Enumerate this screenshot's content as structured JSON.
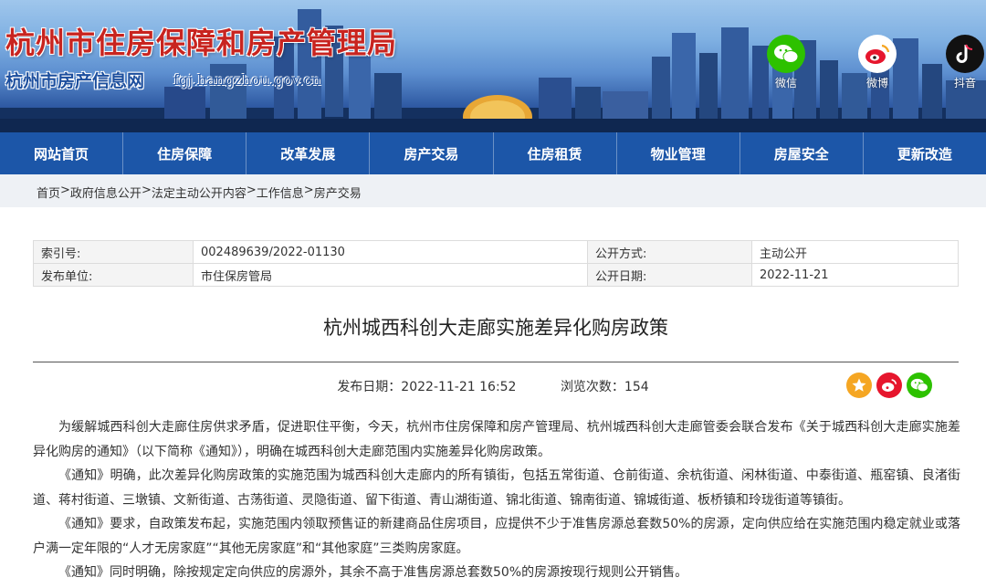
{
  "header": {
    "title": "杭州市住房保障和房产管理局",
    "subtitle": "杭州市房产信息网",
    "url": "fgj.hangzhou.gov.cn",
    "social": [
      {
        "label": "微信",
        "icon": "wechat-icon",
        "color": "#2dc100"
      },
      {
        "label": "微博",
        "icon": "weibo-icon",
        "color": "#e6162d"
      },
      {
        "label": "抖音",
        "icon": "douyin-icon",
        "color": "#111111"
      }
    ]
  },
  "nav": {
    "items": [
      "网站首页",
      "住房保障",
      "改革发展",
      "房产交易",
      "住房租赁",
      "物业管理",
      "房屋安全",
      "更新改造"
    ]
  },
  "breadcrumb": [
    "首页",
    "政府信息公开",
    "法定主动公开内容",
    "工作信息",
    "房产交易"
  ],
  "meta": {
    "index_label": "索引号:",
    "index_value": "002489639/2022-01130",
    "open_mode_label": "公开方式:",
    "open_mode_value": "主动公开",
    "publisher_label": "发布单位:",
    "publisher_value": "市住保房管局",
    "open_date_label": "公开日期:",
    "open_date_value": "2022-11-21"
  },
  "article": {
    "title": "杭州城西科创大走廊实施差异化购房政策",
    "publish_label": "发布日期：2022-11-21 16:52",
    "views_label": "浏览次数：154",
    "paragraphs": [
      "为缓解城西科创大走廊住房供求矛盾，促进职住平衡，今天，杭州市住房保障和房产管理局、杭州城西科创大走廊管委会联合发布《关于城西科创大走廊实施差异化购房的通知》（以下简称《通知》），明确在城西科创大走廊范围内实施差异化购房政策。",
      "《通知》明确，此次差异化购房政策的实施范围为城西科创大走廊内的所有镇街，包括五常街道、仓前街道、余杭街道、闲林街道、中泰街道、瓶窑镇、良渚街道、蒋村街道、三墩镇、文新街道、古荡街道、灵隐街道、留下街道、青山湖街道、锦北街道、锦南街道、锦城街道、板桥镇和玲珑街道等镇街。",
      "《通知》要求，自政策发布起，实施范围内领取预售证的新建商品住房项目，应提供不少于准售房源总套数50%的房源，定向供应给在实施范围内稳定就业或落户满一定年限的“人才无房家庭”“其他无房家庭”和“其他家庭”三类购房家庭。",
      "《通知》同时明确，除按规定定向供应的房源外，其余不高于准售房源总套数50%的房源按现行规则公开销售。"
    ]
  },
  "share": [
    {
      "icon": "favorite-icon",
      "color": "#f5a623"
    },
    {
      "icon": "weibo-icon",
      "color": "#e6162d"
    },
    {
      "icon": "wechat-icon",
      "color": "#2dc100"
    }
  ]
}
